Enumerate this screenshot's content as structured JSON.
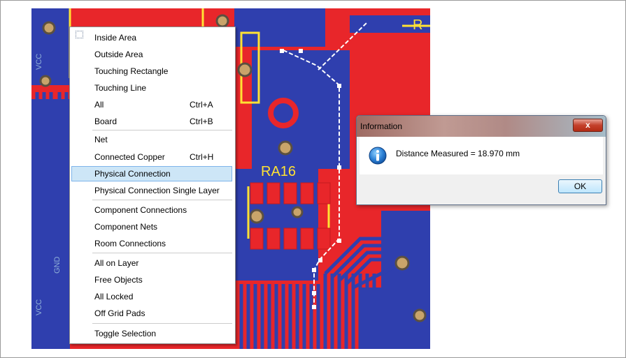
{
  "context_menu": {
    "items": [
      {
        "label": "Inside Area",
        "shortcut": ""
      },
      {
        "label": "Outside Area",
        "shortcut": ""
      },
      {
        "label": "Touching Rectangle",
        "shortcut": ""
      },
      {
        "label": "Touching Line",
        "shortcut": ""
      },
      {
        "label": "All",
        "shortcut": "Ctrl+A"
      },
      {
        "label": "Board",
        "shortcut": "Ctrl+B"
      },
      {
        "label": "Net",
        "shortcut": ""
      },
      {
        "label": "Connected Copper",
        "shortcut": "Ctrl+H"
      },
      {
        "label": "Physical Connection",
        "shortcut": ""
      },
      {
        "label": "Physical Connection Single Layer",
        "shortcut": ""
      },
      {
        "label": "Component Connections",
        "shortcut": ""
      },
      {
        "label": "Component Nets",
        "shortcut": ""
      },
      {
        "label": "Room Connections",
        "shortcut": ""
      },
      {
        "label": "All on Layer",
        "shortcut": ""
      },
      {
        "label": "Free Objects",
        "shortcut": ""
      },
      {
        "label": "All Locked",
        "shortcut": ""
      },
      {
        "label": "Off Grid Pads",
        "shortcut": ""
      },
      {
        "label": "Toggle Selection",
        "shortcut": ""
      }
    ],
    "highlighted": "Physical Connection"
  },
  "dialog": {
    "title": "Information",
    "message": "Distance Measured = 18.970 mm",
    "ok_label": "OK",
    "close_label": "x",
    "icon": "info-icon"
  },
  "pcb": {
    "designators": [
      "RA16",
      "VCC",
      "VCC",
      "GND",
      "R"
    ]
  },
  "colors": {
    "board_red": "#e8262a",
    "trace_blue": "#2f3fae",
    "silkscreen_yellow": "#ffe234",
    "menu_highlight": "#cde6f7"
  }
}
